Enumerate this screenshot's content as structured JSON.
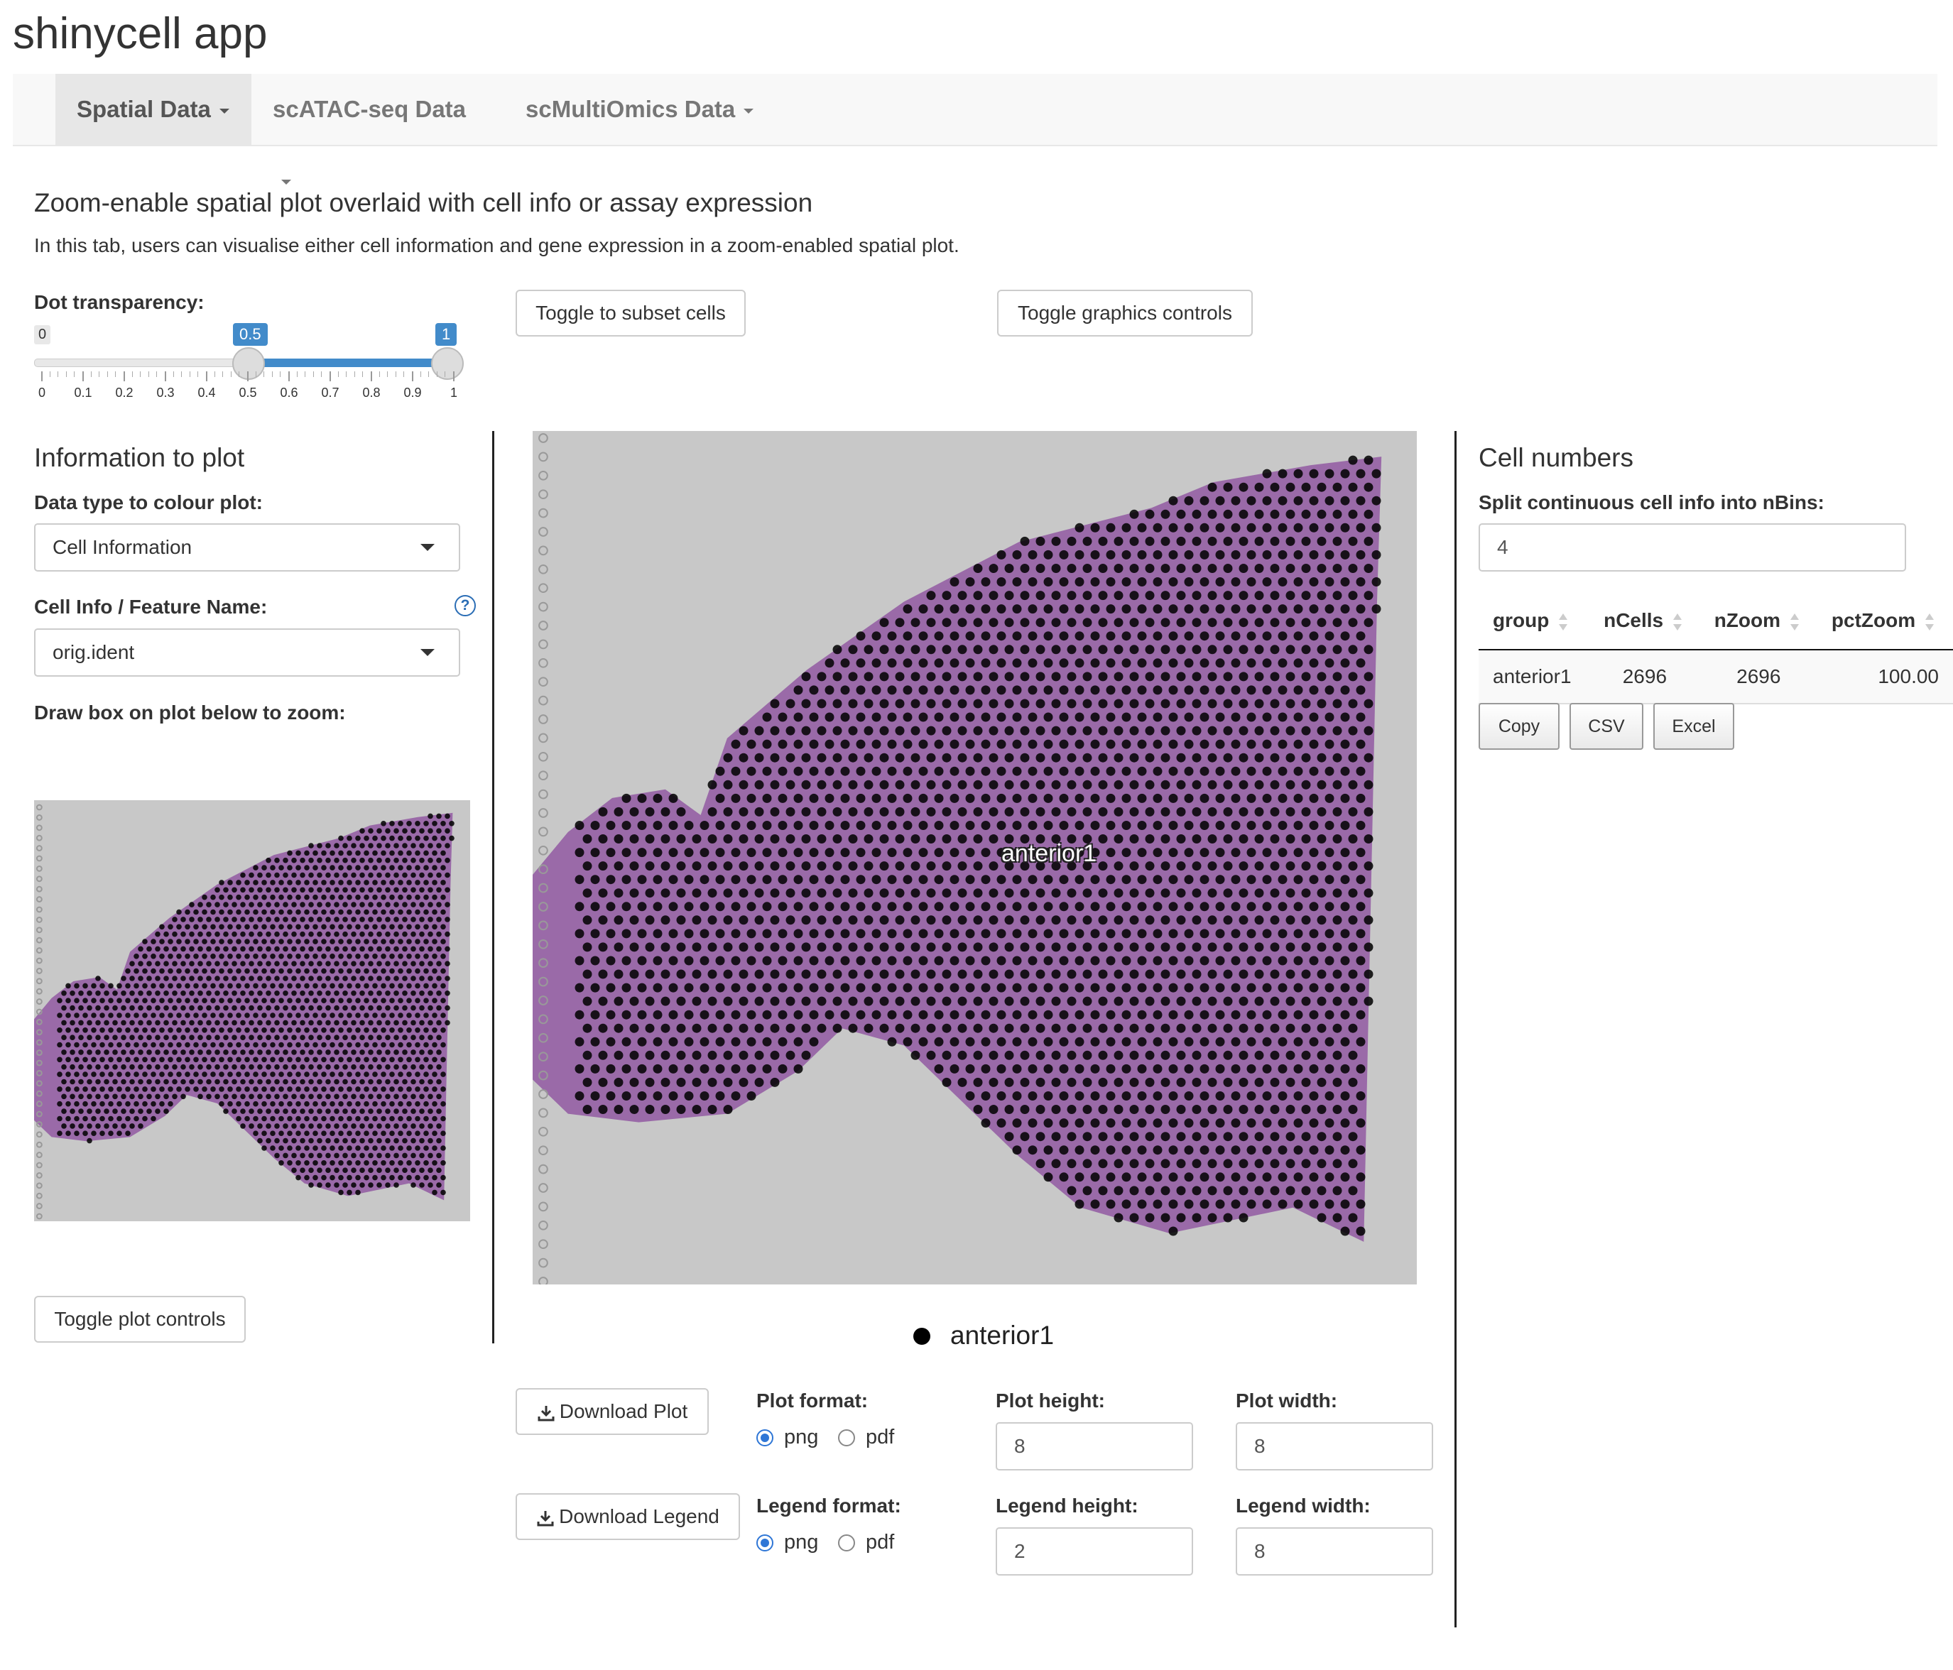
{
  "app": {
    "title": "shinycell app"
  },
  "nav": {
    "items": [
      {
        "label": "Spatial Data",
        "active": true
      },
      {
        "label": "scATAC-seq Data",
        "active": false
      },
      {
        "label": "scMultiOmics Data",
        "active": false
      }
    ]
  },
  "page": {
    "heading": "Zoom-enable spatial plot overlaid with cell info or assay expression",
    "description": "In this tab, users can visualise either cell information and gene expression in a zoom-enabled spatial plot."
  },
  "slider": {
    "label": "Dot transparency:",
    "min_label": "0",
    "from_label": "0.5",
    "to_label": "1",
    "from": 0.5,
    "to": 1,
    "ticks": [
      "0",
      "0.1",
      "0.2",
      "0.3",
      "0.4",
      "0.5",
      "0.6",
      "0.7",
      "0.8",
      "0.9",
      "1"
    ],
    "accent": "#428bca"
  },
  "toolbar": {
    "subset_label": "Toggle to subset cells",
    "graphics_label": "Toggle graphics controls"
  },
  "left": {
    "title": "Information to plot",
    "datatype_label": "Data type to colour plot:",
    "datatype_value": "Cell Information",
    "feature_label": "Cell Info / Feature Name:",
    "help_icon": "?",
    "feature_value": "orig.ident",
    "draw_label": "Draw box on plot below to zoom:",
    "plot_controls_label": "Toggle plot controls"
  },
  "plot": {
    "cluster_label": "anterior1",
    "legend_label": "anterior1",
    "tissue_color": "#9a6aa8",
    "dot_color": "#000000",
    "bg_color": "#c8c8c8"
  },
  "downloads": {
    "plot_button": "Download Plot",
    "legend_button": "Download Legend",
    "plot_format_label": "Plot format:",
    "legend_format_label": "Legend format:",
    "png": "png",
    "pdf": "pdf",
    "plot_height_label": "Plot height:",
    "plot_width_label": "Plot width:",
    "legend_height_label": "Legend height:",
    "legend_width_label": "Legend width:",
    "plot_height": "8",
    "plot_width": "8",
    "legend_height": "2",
    "legend_width": "8"
  },
  "right": {
    "title": "Cell numbers",
    "bins_label": "Split continuous cell info into nBins:",
    "bins_value": "4",
    "table": {
      "headers": [
        "group",
        "nCells",
        "nZoom",
        "pctZoom"
      ],
      "rows": [
        [
          "anterior1",
          "2696",
          "2696",
          "100.00"
        ]
      ]
    },
    "copy": "Copy",
    "csv": "CSV",
    "excel": "Excel"
  }
}
